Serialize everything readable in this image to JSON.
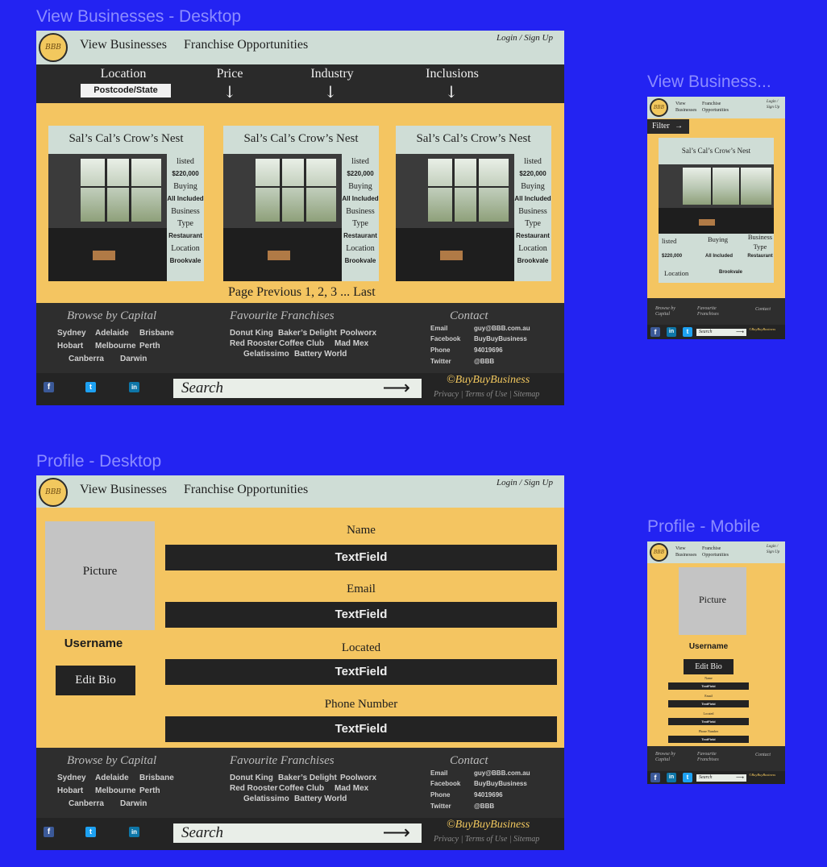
{
  "frames": {
    "view_desktop": "View Businesses - Desktop",
    "view_mobile": "View Business...",
    "profile_desktop": "Profile - Desktop",
    "profile_mobile": "Profile - Mobile"
  },
  "header": {
    "logo_text": "BBB",
    "nav_view": "View Businesses",
    "nav_franchise": "Franchise Opportunities",
    "login": "Login / Sign Up",
    "mobile_nav_view_1": "View",
    "mobile_nav_view_2": "Businesses",
    "mobile_nav_franchise_1": "Franchise",
    "mobile_nav_franchise_2": "Opportunities",
    "mobile_login_1": "Login /",
    "mobile_login_2": "Sign Up"
  },
  "filters": {
    "location": "Location",
    "postcode_placeholder": "Postcode/State",
    "price": "Price",
    "industry": "Industry",
    "inclusions": "Inclusions",
    "arrow": "↓",
    "mobile_filter": "Filter",
    "mobile_filter_arrow": "→"
  },
  "listing": {
    "title": "Sal’s Cal’s Crow’s Nest",
    "listed_label": "listed",
    "price": "$220,000",
    "buying_label": "Buying",
    "inclusions": "All Included",
    "type_label_1": "Business",
    "type_label_2": "Type",
    "type": "Restaurant",
    "location_label": "Location",
    "location": "Brookvale"
  },
  "pager": "Page Previous 1, 2, 3 ... Last",
  "footer": {
    "browse_title": "Browse by Capital",
    "browse_title_m1": "Browse by",
    "browse_title_m2": "Capital",
    "capitals": [
      "Sydney",
      "Adelaide",
      "Brisbane",
      "Hobart",
      "Melbourne",
      "Perth",
      "Canberra",
      "Darwin"
    ],
    "fav_title": "Favourite Franchises",
    "fav_title_m1": "Favourite",
    "fav_title_m2": "Franchises",
    "franchises": [
      "Donut King",
      "Baker’s Delight",
      "Poolworx",
      "Red Rooster",
      "Coffee Club",
      "Mad Mex",
      "Gelatissimo",
      "Battery World"
    ],
    "contact_title": "Contact",
    "contact": [
      {
        "label": "Email",
        "value": "guy@BBB.com.au"
      },
      {
        "label": "Facebook",
        "value": "BuyBuyBusiness"
      },
      {
        "label": "Phone",
        "value": "94019696"
      },
      {
        "label": "Twitter",
        "value": "@BBB"
      }
    ],
    "search_placeholder": "Search",
    "search_arrow": "⟶",
    "brand": "©BuyBuyBusiness",
    "legal": "Privacy | Terms of Use | Sitemap",
    "fb": "f",
    "tw": "t",
    "li": "in"
  },
  "profile": {
    "picture": "Picture",
    "username": "Username",
    "edit_bio": "Edit Bio",
    "fields": [
      {
        "label": "Name",
        "value": "TextField"
      },
      {
        "label": "Email",
        "value": "TextField"
      },
      {
        "label": "Located",
        "value": "TextField"
      },
      {
        "label": "Phone Number",
        "value": "TextField"
      }
    ]
  }
}
